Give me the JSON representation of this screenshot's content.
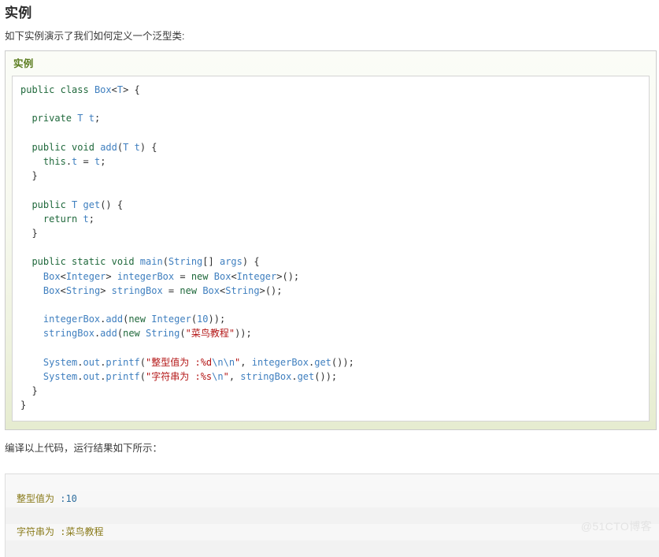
{
  "page": {
    "title": "实例",
    "intro": "如下实例演示了我们如何定义一个泛型类:",
    "result_intro": "编译以上代码，运行结果如下所示：",
    "watermark": "@51CTO博客"
  },
  "example_panel": {
    "header": "实例",
    "language": "java",
    "code_lines": [
      "public class Box<T> {",
      "",
      "  private T t;",
      "",
      "  public void add(T t) {",
      "    this.t = t;",
      "  }",
      "",
      "  public T get() {",
      "    return t;",
      "  }",
      "",
      "  public static void main(String[] args) {",
      "    Box<Integer> integerBox = new Box<Integer>();",
      "    Box<String> stringBox = new Box<String>();",
      "",
      "    integerBox.add(new Integer(10));",
      "    stringBox.add(new String(\"菜鸟教程\"));",
      "",
      "    System.out.printf(\"整型值为 :%d\\n\\n\", integerBox.get());",
      "    System.out.printf(\"字符串为 :%s\\n\", stringBox.get());",
      "  }",
      "}"
    ]
  },
  "output_console": {
    "rows": [
      {
        "text": "整型值为 :10",
        "value": ""
      },
      {
        "text": "",
        "value": ""
      },
      {
        "text": "字符串为 :菜鸟教程",
        "value": ""
      },
      {
        "text": "",
        "value": ""
      }
    ],
    "line1_label": "整型值为 ",
    "line1_value": ":10",
    "line2_label": "字符串为 :菜鸟教程"
  },
  "colors": {
    "keyword": "#20693c",
    "type": "#3f7fbf",
    "string": "#b31515",
    "escape": "#3f7fbf",
    "panel_border": "#cccccc",
    "panel_header_text": "#5a7c1e",
    "output_bg": "#f7f7f7",
    "output_text": "#8a7b1b",
    "output_value": "#2f6e9e",
    "watermark": "#e3e3e3"
  }
}
